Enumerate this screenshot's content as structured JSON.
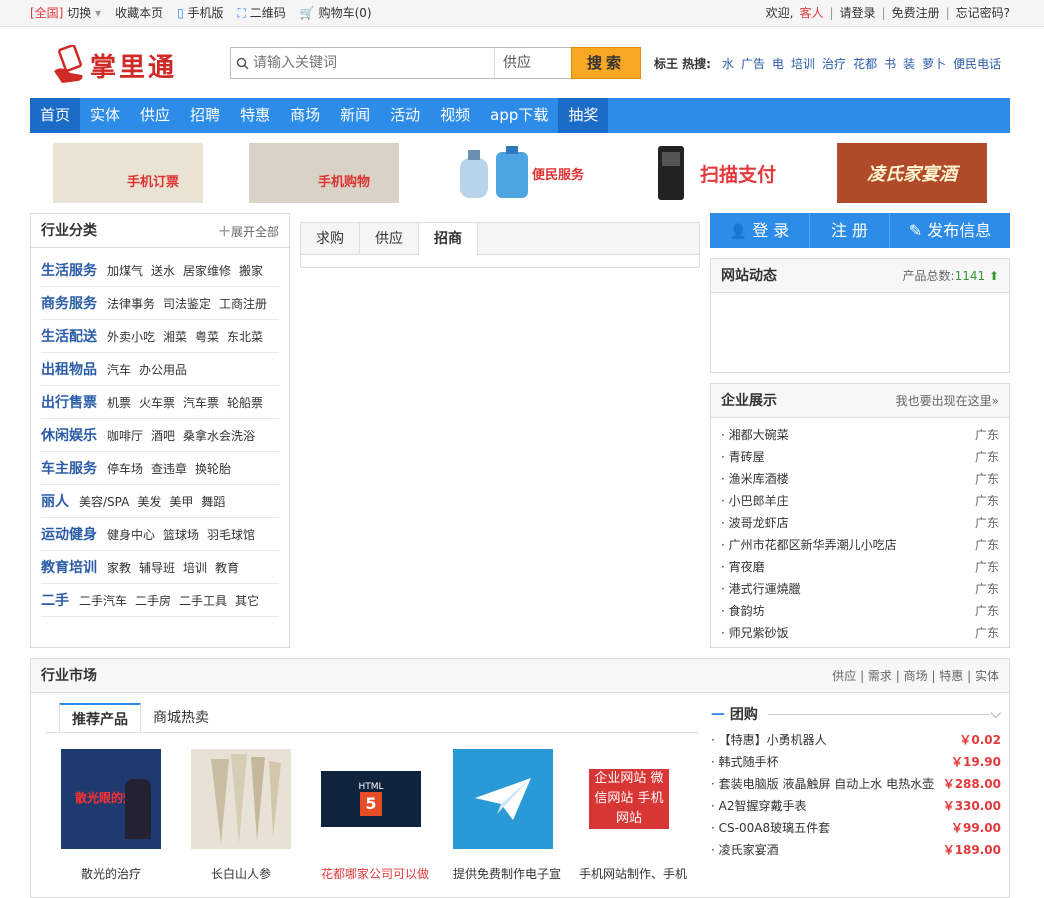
{
  "topbar": {
    "region": "[全国]",
    "switch": "切换",
    "bookmark": "收藏本页",
    "mobile": "手机版",
    "qrcode": "二维码",
    "cart": "购物车(0)",
    "welcome": "欢迎,",
    "guest": "客人",
    "login": "请登录",
    "register": "免费注册",
    "forgot": "忘记密码?"
  },
  "logo": {
    "text": "掌里通"
  },
  "search": {
    "placeholder": "请输入关键词",
    "type": "供应",
    "button": "搜索"
  },
  "hot": {
    "label": "标王 热搜:",
    "keywords": [
      "水",
      "广告",
      "电",
      "培训",
      "治疗",
      "花都",
      "书",
      "装",
      "萝卜",
      "便民电话"
    ]
  },
  "nav": {
    "items": [
      "首页",
      "实体",
      "供应",
      "招聘",
      "特惠",
      "商场",
      "新闻",
      "活动",
      "视频",
      "app下载",
      "抽奖"
    ]
  },
  "banners": [
    "手机订票",
    "手机购物",
    "便民服务",
    "扫描支付",
    "凌氏家宴酒"
  ],
  "category": {
    "title": "行业分类",
    "expand": "展开全部",
    "rows": [
      {
        "head": "生活服务",
        "items": [
          "加煤气",
          "送水",
          "居家维修",
          "搬家"
        ]
      },
      {
        "head": "商务服务",
        "items": [
          "法律事务",
          "司法鉴定",
          "工商注册"
        ]
      },
      {
        "head": "生活配送",
        "items": [
          "外卖小吃",
          "湘菜",
          "粤菜",
          "东北菜"
        ]
      },
      {
        "head": "出租物品",
        "items": [
          "汽车",
          "办公用品"
        ]
      },
      {
        "head": "出行售票",
        "items": [
          "机票",
          "火车票",
          "汽车票",
          "轮船票"
        ]
      },
      {
        "head": "休闲娱乐",
        "items": [
          "咖啡厅",
          "酒吧",
          "桑拿水会洗浴"
        ]
      },
      {
        "head": "车主服务",
        "items": [
          "停车场",
          "查违章",
          "换轮胎"
        ]
      },
      {
        "head": "丽人",
        "items": [
          "美容/SPA",
          "美发",
          "美甲",
          "舞蹈"
        ]
      },
      {
        "head": "运动健身",
        "items": [
          "健身中心",
          "篮球场",
          "羽毛球馆"
        ]
      },
      {
        "head": "教育培训",
        "items": [
          "家教",
          "辅导班",
          "培训",
          "教育"
        ]
      },
      {
        "head": "二手",
        "items": [
          "二手汽车",
          "二手房",
          "二手工具",
          "其它"
        ]
      }
    ]
  },
  "midtabs": [
    "求购",
    "供应",
    "招商"
  ],
  "account": {
    "login": "登 录",
    "register": "注 册",
    "publish": "发布信息"
  },
  "news": {
    "title": "网站动态",
    "count_label": "产品总数:",
    "count": "1141"
  },
  "company": {
    "title": "企业展示",
    "more": "我也要出现在这里»",
    "items": [
      {
        "name": "湘都大碗菜",
        "area": "广东"
      },
      {
        "name": "青砖屋",
        "area": "广东"
      },
      {
        "name": "渔米库酒楼",
        "area": "广东"
      },
      {
        "name": "小巴郎羊庄",
        "area": "广东"
      },
      {
        "name": "波哥龙虾店",
        "area": "广东"
      },
      {
        "name": "广州市花都区新华弄潮儿小吃店",
        "area": "广东"
      },
      {
        "name": "宵夜磨",
        "area": "广东"
      },
      {
        "name": "港式行運燒臘",
        "area": "广东"
      },
      {
        "name": "食韵坊",
        "area": "广东"
      },
      {
        "name": "师兄紫砂饭",
        "area": "广东"
      }
    ]
  },
  "market": {
    "title": "行业市场",
    "links": [
      "供应",
      "需求",
      "商场",
      "特惠",
      "实体"
    ],
    "tabs": [
      "推荐产品",
      "商城热卖"
    ],
    "products": [
      {
        "caption": "散光的治疗",
        "img_text": "散光眼的效果"
      },
      {
        "caption": "长白山人参",
        "img_text": ""
      },
      {
        "caption": "花都哪家公司可以做",
        "img_text": "HTML"
      },
      {
        "caption": "提供免费制作电子宣",
        "img_text": ""
      },
      {
        "caption": "手机网站制作、手机",
        "img_text": "企业网站 微信网站 手机网站"
      }
    ]
  },
  "groupbuy": {
    "title": "团购",
    "items": [
      {
        "name": "【特惠】小勇机器人",
        "price": "￥0.02"
      },
      {
        "name": "韩式随手杯",
        "price": "￥19.90"
      },
      {
        "name": "套装电脑版 液晶触屏 自动上水 电热水壶",
        "price": "￥288.00"
      },
      {
        "name": "A2智握穿戴手表",
        "price": "￥330.00"
      },
      {
        "name": "CS-00A8玻璃五件套",
        "price": "￥99.00"
      },
      {
        "name": "凌氏家宴酒",
        "price": "￥189.00"
      }
    ]
  },
  "colors": {
    "accent": "#2d8ce8",
    "red": "#e4393c",
    "link": "#2a5ca8",
    "search_btn": "#f9a824"
  }
}
